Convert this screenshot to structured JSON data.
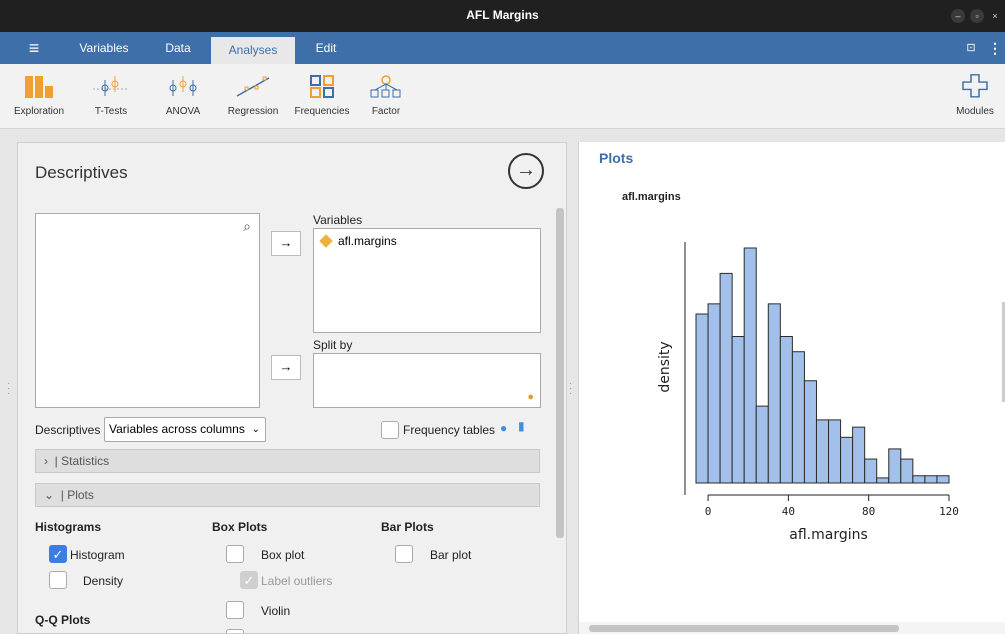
{
  "window": {
    "title": "AFL Margins"
  },
  "menubar": {
    "items": [
      "Variables",
      "Data",
      "Analyses",
      "Edit"
    ],
    "active": "Analyses"
  },
  "toolbar": {
    "tools": [
      "Exploration",
      "T-Tests",
      "ANOVA",
      "Regression",
      "Frequencies",
      "Factor"
    ],
    "modules": "Modules"
  },
  "descriptives": {
    "title": "Descriptives",
    "variables_label": "Variables",
    "variables": [
      "afl.margins"
    ],
    "split_by_label": "Split by",
    "descriptives_label": "Descriptives",
    "layout_select": "Variables across columns",
    "frequency_tables": "Frequency tables",
    "statistics_section": "Statistics",
    "plots_section": "Plots",
    "histograms_head": "Histograms",
    "histogram": "Histogram",
    "density": "Density",
    "boxplots_head": "Box Plots",
    "box_plot": "Box plot",
    "label_outliers": "Label outliers",
    "violin": "Violin",
    "barplots_head": "Bar Plots",
    "bar_plot": "Bar plot",
    "qq_head": "Q-Q Plots"
  },
  "results": {
    "heading": "Plots",
    "plot_title": "afl.margins"
  },
  "chart_data": {
    "type": "bar",
    "title": "afl.margins",
    "xlabel": "afl.margins",
    "ylabel": "density",
    "bin_width": 6,
    "bin_starts": [
      -6,
      0,
      6,
      12,
      18,
      24,
      30,
      36,
      42,
      48,
      54,
      60,
      66,
      72,
      78,
      84,
      90,
      96,
      102,
      108,
      114
    ],
    "values": [
      0.0233,
      0.0247,
      0.0289,
      0.0202,
      0.0324,
      0.0106,
      0.0247,
      0.0202,
      0.0181,
      0.0141,
      0.0087,
      0.0087,
      0.0063,
      0.0077,
      0.0033,
      0.0007,
      0.0047,
      0.0033,
      0.001,
      0.001,
      0.001
    ],
    "xticks": [
      0,
      40,
      80,
      120
    ],
    "xlim": [
      -6,
      120
    ],
    "ylim": [
      0,
      0.0324
    ],
    "grid": false,
    "bar_color": "#a2c0ea",
    "bar_edge": "#2b2b2b"
  },
  "colors": {
    "menubar": "#3e6fa8",
    "accent": "#3b7de0"
  }
}
